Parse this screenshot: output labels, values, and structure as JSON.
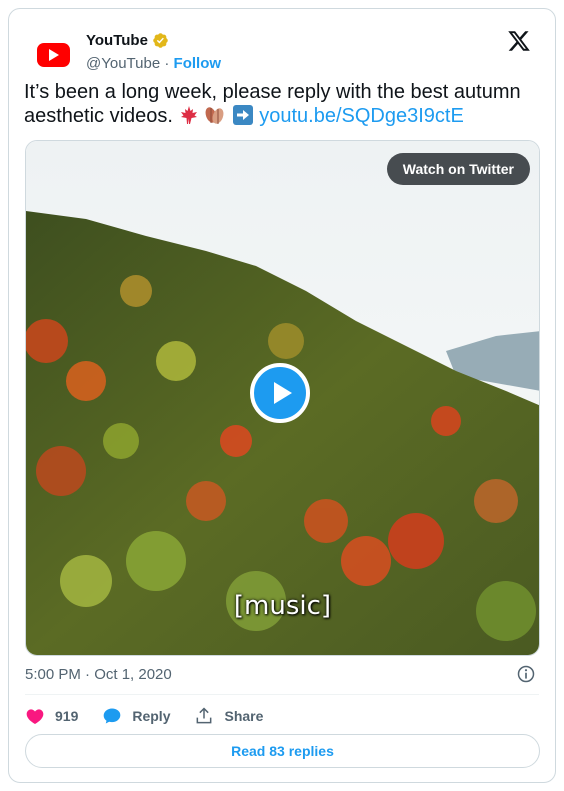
{
  "author": {
    "display_name": "YouTube",
    "handle": "@YouTube",
    "separator": "·",
    "follow_label": "Follow",
    "brand_color": "#ff0000",
    "verified_icon": "gold-verified-badge-icon"
  },
  "platform_icon": "x-logo-icon",
  "tweet": {
    "text": "It’s been a long week, please reply with the best autumn aesthetic videos.",
    "emojis": [
      "maple-leaf-icon",
      "fallen-leaf-icon",
      "right-arrow-icon"
    ],
    "link": "youtu.be/SQDge3I9ctE"
  },
  "media": {
    "watch_label": "Watch on Twitter",
    "caption": "[music]",
    "play_icon": "play-icon"
  },
  "timestamp": "5:00 PM · Oct 1, 2020",
  "actions": {
    "like_count": "919",
    "reply_label": "Reply",
    "share_label": "Share"
  },
  "read_replies_label": "Read 83 replies",
  "colors": {
    "accent": "#1d9bf0",
    "like": "#f91880",
    "muted": "#536471",
    "border": "#cfd9de"
  }
}
